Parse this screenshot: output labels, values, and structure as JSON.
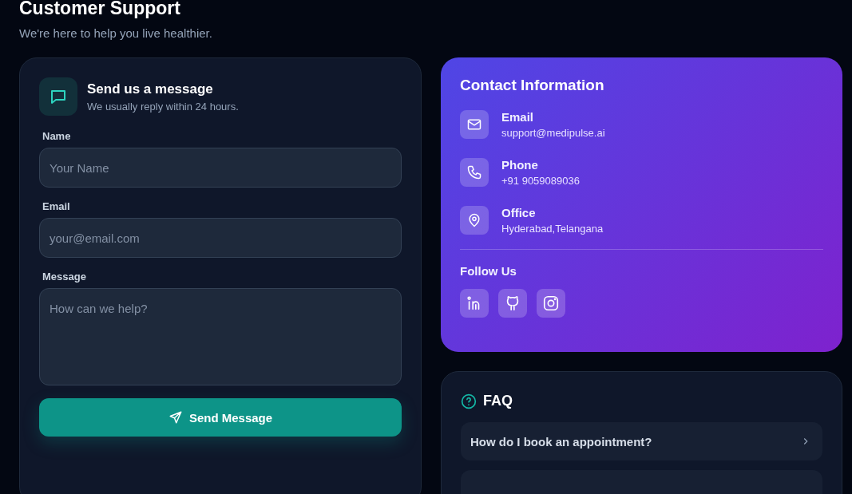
{
  "header": {
    "title": "Customer Support",
    "subtitle": "We're here to help you live healthier."
  },
  "form": {
    "title": "Send us a message",
    "subtitle": "We usually reply within 24 hours.",
    "fields": [
      {
        "kind": "text",
        "label": "Name",
        "placeholder": "Your Name"
      },
      {
        "kind": "text",
        "label": "Email",
        "placeholder": "your@email.com"
      },
      {
        "kind": "textarea",
        "label": "Message",
        "placeholder": "How can we help?"
      }
    ],
    "button": "Send Message"
  },
  "contact": {
    "title": "Contact Information",
    "items": [
      {
        "kind": "email",
        "label": "Email",
        "value": "support@medipulse.ai"
      },
      {
        "kind": "phone",
        "label": "Phone",
        "value": "+91 9059089036"
      },
      {
        "kind": "office",
        "label": "Office",
        "value": "Hyderabad,Telangana"
      }
    ],
    "follow_title": "Follow Us",
    "socials": [
      {
        "kind": "linkedin"
      },
      {
        "kind": "github"
      },
      {
        "kind": "instagram"
      }
    ]
  },
  "faq": {
    "title": "FAQ",
    "items": [
      "How do I book an appointment?"
    ]
  }
}
